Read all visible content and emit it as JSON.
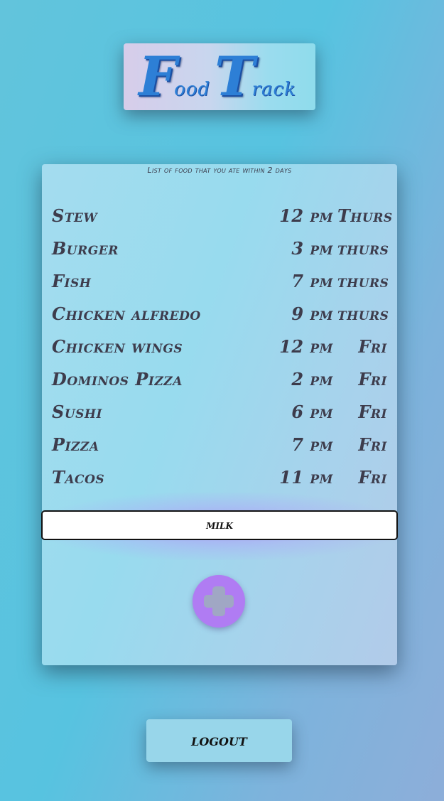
{
  "logo": {
    "first_initial": "F",
    "first_rest": "ood",
    "second_initial": "T",
    "second_rest": "rack",
    "color": "#2d7fd6"
  },
  "card": {
    "caption": "List of food that you ate within 2 days",
    "items": [
      {
        "name": "Stew",
        "time": "12 pm",
        "day": "Thurs"
      },
      {
        "name": "Burger",
        "time": "3 pm",
        "day": "thurs"
      },
      {
        "name": "Fish",
        "time": "7 pm",
        "day": "thurs"
      },
      {
        "name": "Chicken alfredo",
        "time": "9 pm",
        "day": "thurs"
      },
      {
        "name": "Chicken wings",
        "time": "12 pm",
        "day": "Fri"
      },
      {
        "name": "Dominos Pizza",
        "time": "2 pm",
        "day": "Fri"
      },
      {
        "name": "Sushi",
        "time": "6 pm",
        "day": "Fri"
      },
      {
        "name": "Pizza",
        "time": "7 pm",
        "day": "Fri"
      },
      {
        "name": "Tacos",
        "time": "11 pm",
        "day": "Fri"
      }
    ],
    "input_value": "milk",
    "add_icon": "plus-icon",
    "add_color": "#b07cf3"
  },
  "logout": {
    "label": "logout"
  }
}
